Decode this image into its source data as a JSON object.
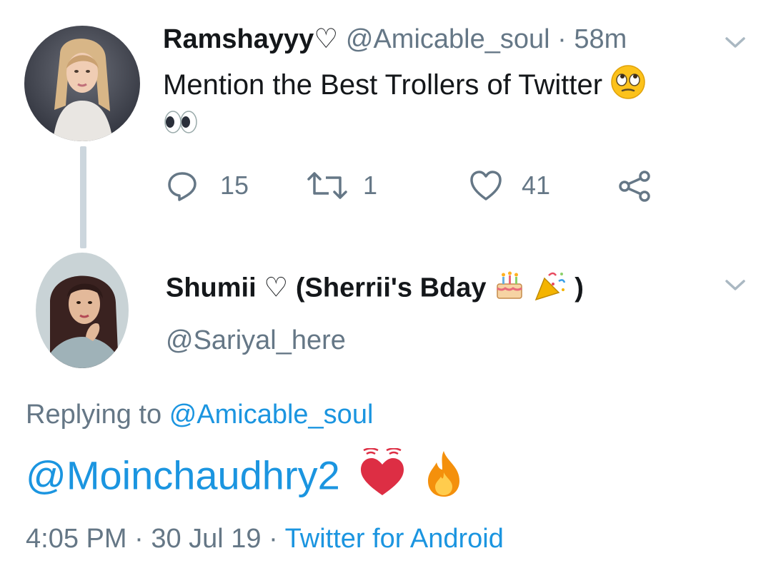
{
  "original_tweet": {
    "display_name": "Ramshayyy♡",
    "handle": "@Amicable_soul",
    "separator": "·",
    "time": "58m",
    "text": "Mention the Best Trollers of Twitter",
    "emoji_inline": "🙄",
    "emoji_line2": "👀",
    "counts": {
      "replies": "15",
      "retweets": "1",
      "likes": "41"
    },
    "icons": {
      "reply": "reply-icon",
      "retweet": "retweet-icon",
      "like": "heart-icon",
      "share": "share-icon",
      "menu": "chevron-down-icon"
    }
  },
  "reply_tweet": {
    "display_name": "Shumii ♡ (Sherrii's Bday",
    "display_name_emojis": "🎂🎉",
    "display_name_close": ")",
    "handle": "@Sariyal_here",
    "replying_prefix": "Replying to",
    "replying_handle": "@Amicable_soul",
    "mention": "@Moinchaudhry2",
    "emojis": "💓🔥",
    "timestamp": "4:05 PM",
    "date": "30 Jul 19",
    "source": "Twitter for Android",
    "separator": "·"
  },
  "colors": {
    "text_primary": "#14171a",
    "text_secondary": "#657786",
    "link": "#1b95e0",
    "thread_line": "#ccd6dd"
  }
}
